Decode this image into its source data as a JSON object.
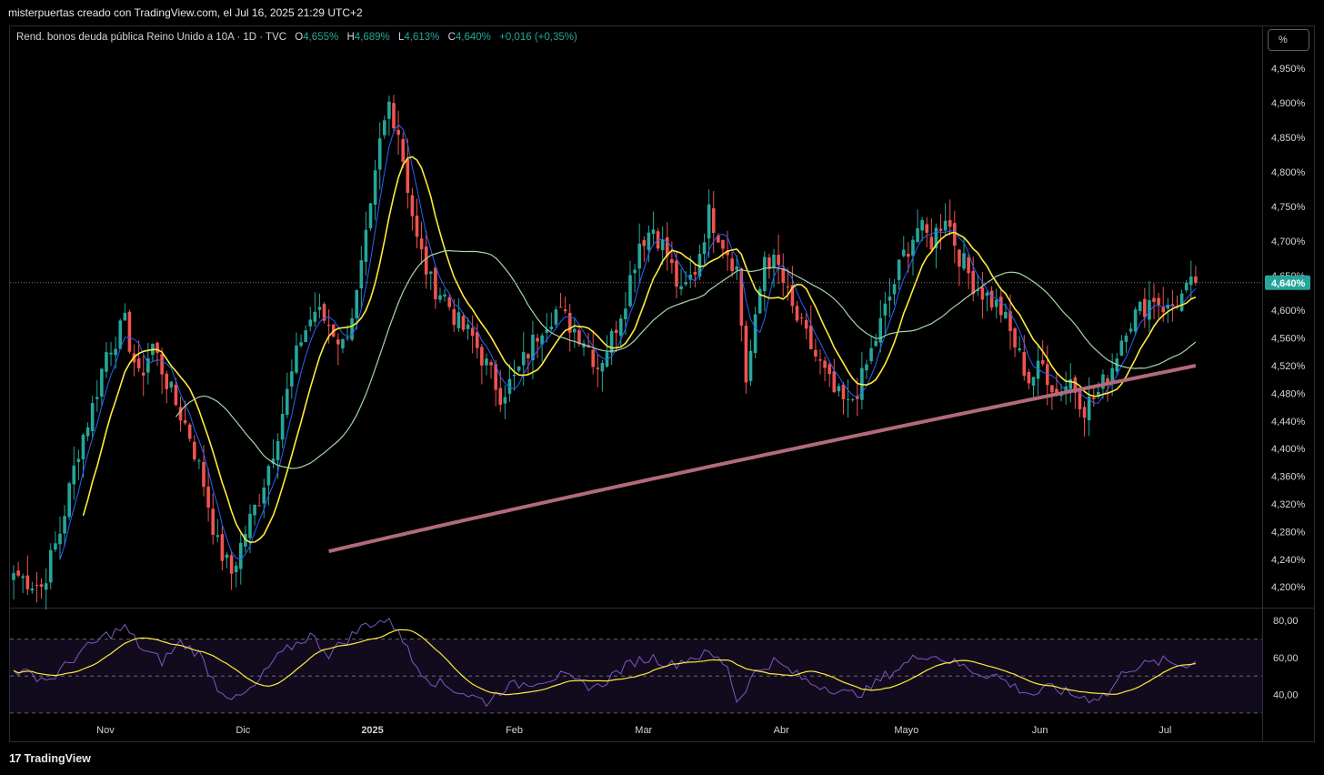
{
  "header": {
    "author_line": "misterpuertas creado con TradingView.com, el Jul 16, 2025 21:29 UTC+2"
  },
  "legend": {
    "symbol": "Rend. bonos deuda pública Reino Unido a 10A · 1D · TVC",
    "open_label": "O",
    "open": "4,655%",
    "high_label": "H",
    "high": "4,689%",
    "low_label": "L",
    "low": "4,613%",
    "close_label": "C",
    "close": "4,640%",
    "change": "+0,016 (+0,35%)"
  },
  "scale_button": "%",
  "footer": {
    "brand": "TradingView",
    "logo_mark": "17"
  },
  "colors": {
    "up": "#26a69a",
    "down": "#ef5350",
    "sma_blue": "#2962ff",
    "sma_yellow": "#ffeb3b",
    "sma_green": "#a5d6a7",
    "sma_maroon": "#b26a7a",
    "rsi": "#7e57c2",
    "rsi_ma": "#ffeb3b",
    "price_tag": "#26a69a"
  },
  "chart_data": [
    {
      "type": "candlestick",
      "series_name": "Rend. bonos deuda pública Reino Unido a 10A",
      "ylim": [
        4.17,
        4.97
      ],
      "y_ticks": [
        "4,950%",
        "4,900%",
        "4,850%",
        "4,800%",
        "4,750%",
        "4,700%",
        "4,650%",
        "4,600%",
        "4,560%",
        "4,520%",
        "4,480%",
        "4,440%",
        "4,400%",
        "4,360%",
        "4,320%",
        "4,280%",
        "4,240%",
        "4,200%"
      ],
      "y_tick_values": [
        4.95,
        4.9,
        4.85,
        4.8,
        4.75,
        4.7,
        4.65,
        4.6,
        4.56,
        4.52,
        4.48,
        4.44,
        4.4,
        4.36,
        4.32,
        4.28,
        4.24,
        4.2
      ],
      "x_ticks": [
        "Nov",
        "Dic",
        "2025",
        "Feb",
        "Mar",
        "Abr",
        "Mayo",
        "Jun",
        "Jul"
      ],
      "last_price_label": "4,640%",
      "last_price": 4.64,
      "anchor_closes": [
        [
          0,
          4.22
        ],
        [
          6,
          4.2
        ],
        [
          10,
          4.28
        ],
        [
          14,
          4.4
        ],
        [
          17,
          4.46
        ],
        [
          20,
          4.54
        ],
        [
          24,
          4.58
        ],
        [
          27,
          4.5
        ],
        [
          30,
          4.55
        ],
        [
          34,
          4.48
        ],
        [
          38,
          4.42
        ],
        [
          41,
          4.35
        ],
        [
          44,
          4.26
        ],
        [
          47,
          4.22
        ],
        [
          50,
          4.28
        ],
        [
          53,
          4.33
        ],
        [
          56,
          4.4
        ],
        [
          59,
          4.48
        ],
        [
          62,
          4.56
        ],
        [
          65,
          4.6
        ],
        [
          68,
          4.58
        ],
        [
          71,
          4.55
        ],
        [
          74,
          4.62
        ],
        [
          77,
          4.74
        ],
        [
          79,
          4.84
        ],
        [
          81,
          4.9
        ],
        [
          83,
          4.86
        ],
        [
          85,
          4.78
        ],
        [
          87,
          4.7
        ],
        [
          90,
          4.64
        ],
        [
          93,
          4.62
        ],
        [
          96,
          4.58
        ],
        [
          99,
          4.56
        ],
        [
          102,
          4.52
        ],
        [
          105,
          4.48
        ],
        [
          108,
          4.5
        ],
        [
          111,
          4.54
        ],
        [
          114,
          4.58
        ],
        [
          117,
          4.6
        ],
        [
          120,
          4.58
        ],
        [
          123,
          4.56
        ],
        [
          126,
          4.52
        ],
        [
          129,
          4.56
        ],
        [
          132,
          4.62
        ],
        [
          135,
          4.7
        ],
        [
          138,
          4.72
        ],
        [
          141,
          4.68
        ],
        [
          144,
          4.62
        ],
        [
          147,
          4.66
        ],
        [
          150,
          4.74
        ],
        [
          153,
          4.7
        ],
        [
          156,
          4.66
        ],
        [
          158,
          4.5
        ],
        [
          160,
          4.58
        ],
        [
          162,
          4.68
        ],
        [
          165,
          4.66
        ],
        [
          168,
          4.6
        ],
        [
          171,
          4.56
        ],
        [
          174,
          4.52
        ],
        [
          177,
          4.48
        ],
        [
          180,
          4.46
        ],
        [
          183,
          4.5
        ],
        [
          186,
          4.56
        ],
        [
          189,
          4.62
        ],
        [
          192,
          4.68
        ],
        [
          195,
          4.72
        ],
        [
          198,
          4.7
        ],
        [
          201,
          4.74
        ],
        [
          204,
          4.68
        ],
        [
          207,
          4.64
        ],
        [
          210,
          4.62
        ],
        [
          213,
          4.6
        ],
        [
          216,
          4.55
        ],
        [
          219,
          4.5
        ],
        [
          222,
          4.52
        ],
        [
          225,
          4.48
        ],
        [
          228,
          4.5
        ],
        [
          231,
          4.46
        ],
        [
          234,
          4.48
        ],
        [
          237,
          4.52
        ],
        [
          240,
          4.58
        ],
        [
          243,
          4.6
        ],
        [
          246,
          4.62
        ],
        [
          249,
          4.6
        ],
        [
          252,
          4.62
        ],
        [
          255,
          4.64
        ]
      ]
    },
    {
      "type": "line",
      "series_name": "RSI",
      "ylim": [
        27,
        84
      ],
      "y_ticks": [
        "80,00",
        "60,00",
        "40,00"
      ],
      "y_tick_values": [
        80,
        60,
        40
      ],
      "band": [
        30,
        70
      ],
      "midline": 50,
      "anchor_values": [
        [
          0,
          53
        ],
        [
          8,
          48
        ],
        [
          14,
          62
        ],
        [
          20,
          72
        ],
        [
          24,
          76
        ],
        [
          28,
          64
        ],
        [
          32,
          58
        ],
        [
          36,
          68
        ],
        [
          40,
          62
        ],
        [
          44,
          44
        ],
        [
          48,
          37
        ],
        [
          52,
          44
        ],
        [
          56,
          58
        ],
        [
          60,
          66
        ],
        [
          64,
          72
        ],
        [
          68,
          62
        ],
        [
          72,
          70
        ],
        [
          76,
          78
        ],
        [
          80,
          80
        ],
        [
          83,
          76
        ],
        [
          86,
          58
        ],
        [
          90,
          48
        ],
        [
          94,
          44
        ],
        [
          98,
          40
        ],
        [
          102,
          36
        ],
        [
          106,
          44
        ],
        [
          110,
          46
        ],
        [
          114,
          48
        ],
        [
          118,
          50
        ],
        [
          122,
          46
        ],
        [
          126,
          44
        ],
        [
          130,
          52
        ],
        [
          134,
          58
        ],
        [
          138,
          60
        ],
        [
          142,
          56
        ],
        [
          146,
          60
        ],
        [
          150,
          62
        ],
        [
          154,
          56
        ],
        [
          156,
          36
        ],
        [
          160,
          52
        ],
        [
          164,
          58
        ],
        [
          168,
          52
        ],
        [
          172,
          46
        ],
        [
          176,
          44
        ],
        [
          180,
          40
        ],
        [
          184,
          42
        ],
        [
          188,
          50
        ],
        [
          192,
          56
        ],
        [
          196,
          62
        ],
        [
          200,
          60
        ],
        [
          204,
          56
        ],
        [
          208,
          52
        ],
        [
          212,
          50
        ],
        [
          216,
          44
        ],
        [
          220,
          40
        ],
        [
          224,
          44
        ],
        [
          228,
          40
        ],
        [
          232,
          38
        ],
        [
          236,
          40
        ],
        [
          240,
          54
        ],
        [
          244,
          56
        ],
        [
          248,
          58
        ],
        [
          252,
          56
        ],
        [
          255,
          58
        ]
      ]
    }
  ]
}
